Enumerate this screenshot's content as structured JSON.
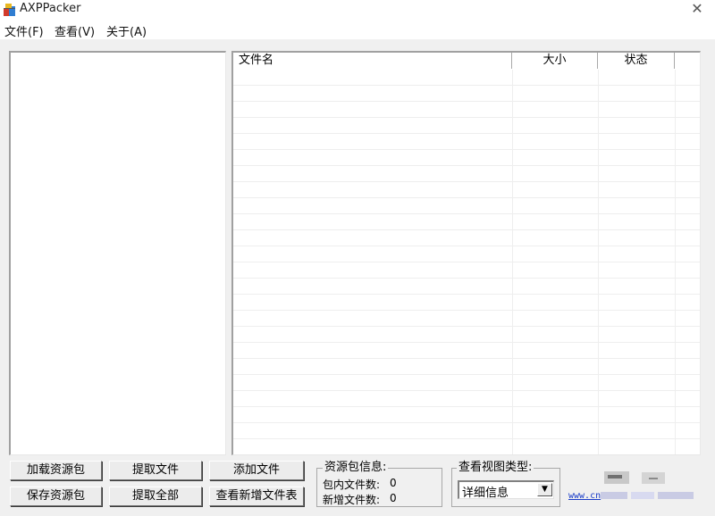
{
  "window": {
    "title": "AXPPacker",
    "icon": "app-package-icon",
    "close_glyph": "✕"
  },
  "menu": [
    {
      "label": "文件(F)"
    },
    {
      "label": "查看(V)"
    },
    {
      "label": "关于(A)"
    }
  ],
  "file_list": {
    "columns": [
      "文件名",
      "大小",
      "状态"
    ],
    "rows": []
  },
  "buttons": {
    "load_package": "加载资源包",
    "save_package": "保存资源包",
    "extract_file": "提取文件",
    "extract_all": "提取全部",
    "add_file": "添加文件",
    "view_new_files": "查看新增文件表"
  },
  "package_info": {
    "title": "资源包信息:",
    "file_count_label": "包内文件数:",
    "file_count": "0",
    "new_count_label": "新增文件数:",
    "new_count": "0"
  },
  "view_type": {
    "title": "查看视图类型:",
    "selected": "详细信息"
  },
  "footer": {
    "link_text": "www.cn"
  },
  "colors": {
    "window_bg": "#f0f0f0",
    "link": "#1a3cc8"
  }
}
